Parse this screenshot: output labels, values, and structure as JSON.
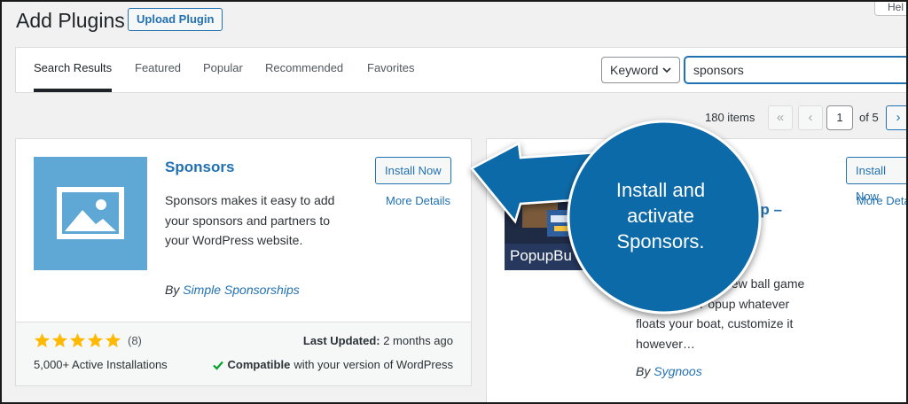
{
  "header": {
    "title": "Add Plugins",
    "upload_label": "Upload Plugin",
    "help_label": "Hel"
  },
  "tabs": [
    {
      "label": "Search Results",
      "active": true
    },
    {
      "label": "Featured",
      "active": false
    },
    {
      "label": "Popular",
      "active": false
    },
    {
      "label": "Recommended",
      "active": false
    },
    {
      "label": "Favorites",
      "active": false
    }
  ],
  "search": {
    "type_label": "Keyword",
    "value": "sponsors"
  },
  "pagination": {
    "items_count": "180 items",
    "first": "«",
    "prev": "‹",
    "current": "1",
    "of_label": "of 5",
    "next": "›"
  },
  "plugin1": {
    "title": "Sponsors",
    "description": "Sponsors makes it easy to add your sponsors and partners to your WordPress website.",
    "author_prefix": "By",
    "author": "Simple Sponsorships",
    "install_label": "Install Now",
    "more_details_label": "More Details",
    "rating_stars": 5,
    "rating_count": "(8)",
    "installs": "5,000+ Active Installations",
    "last_updated_label": "Last Updated:",
    "last_updated_value": "2 months ago",
    "compat_bold": "Compatible",
    "compat_rest": "with your version of WordPress"
  },
  "plugin2": {
    "thumb_text": "PopupBu",
    "title_fragment": "–",
    "title_fragment2": "up –",
    "description": "new ball game … Popup whatever floats your boat, customize it however…",
    "desc_line1": "new ball game",
    "desc_line2": "Popup whatever",
    "desc_line3": "floats your boat, customize it",
    "desc_line4": "however…",
    "author_prefix": "By",
    "author": "Sygnoos",
    "install_label": "Install Now",
    "more_details_label": "More Deta"
  },
  "callout": {
    "text": "Install and activate Sponsors.",
    "color": "#0c6aa8"
  },
  "colors": {
    "link": "#2271b1",
    "background": "#f1f1f1",
    "star": "#ffb900",
    "check": "#00a32a"
  }
}
